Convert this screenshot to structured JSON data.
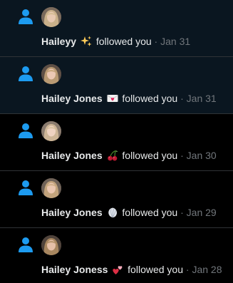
{
  "colors": {
    "accent": "#1d9bf0",
    "unread_bg": "#0a1620",
    "background": "#000000",
    "divider": "#2f3336",
    "muted": "#71767b"
  },
  "notifications": [
    {
      "icon": "person-icon",
      "name": "Haileyy",
      "emoji": "sparkles",
      "action": "followed you",
      "separator": "·",
      "date": "Jan 31",
      "unread": true
    },
    {
      "icon": "person-icon",
      "name": "Hailey Jones",
      "emoji": "love-letter",
      "action": "followed you",
      "separator": "·",
      "date": "Jan 31",
      "unread": true
    },
    {
      "icon": "person-icon",
      "name": "Hailey Jones",
      "emoji": "cherries",
      "action": "followed you",
      "separator": "·",
      "date": "Jan 30",
      "unread": false
    },
    {
      "icon": "person-icon",
      "name": "Hailey Jones",
      "emoji": "shell",
      "action": "followed you",
      "separator": "·",
      "date": "Jan 29",
      "unread": false
    },
    {
      "icon": "person-icon",
      "name": "Hailey Joness",
      "emoji": "two-hearts",
      "action": "followed you",
      "separator": "·",
      "date": "Jan 28",
      "unread": false
    }
  ]
}
